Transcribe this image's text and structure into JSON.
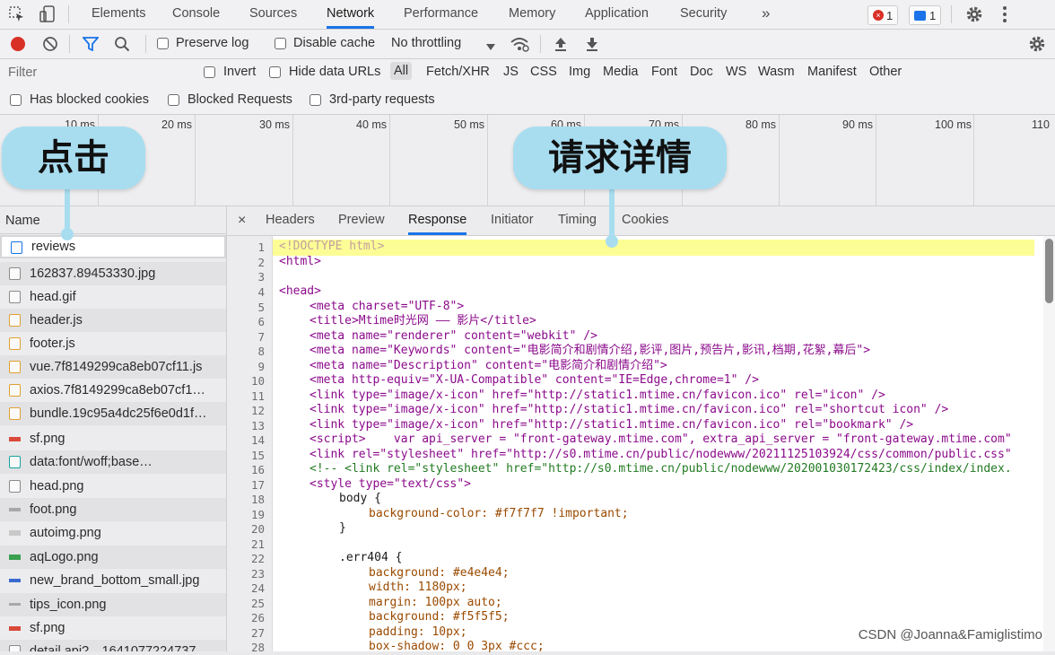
{
  "top_tabs": [
    "Elements",
    "Console",
    "Sources",
    "Network",
    "Performance",
    "Memory",
    "Application",
    "Security"
  ],
  "more_tabs": "»",
  "error_count": "1",
  "message_count": "1",
  "toolbar": {
    "preserve_log": "Preserve log",
    "disable_cache": "Disable cache",
    "throttling": "No throttling"
  },
  "filter": {
    "placeholder": "Filter",
    "invert": "Invert",
    "hide_data_urls": "Hide data URLs",
    "types": [
      "All",
      "Fetch/XHR",
      "JS",
      "CSS",
      "Img",
      "Media",
      "Font",
      "Doc",
      "WS",
      "Wasm",
      "Manifest",
      "Other"
    ]
  },
  "blocked": {
    "has_blocked_cookies": "Has blocked cookies",
    "blocked_requests": "Blocked Requests",
    "third_party": "3rd-party requests"
  },
  "timeline_ticks": [
    "10 ms",
    "20 ms",
    "30 ms",
    "40 ms",
    "50 ms",
    "60 ms",
    "70 ms",
    "80 ms",
    "90 ms",
    "100 ms",
    "110"
  ],
  "requests_header": "Name",
  "requests": [
    "reviews",
    "162837.89453330.jpg",
    "head.gif",
    "header.js",
    "footer.js",
    "vue.7f8149299ca8eb07cf11.js",
    "axios.7f8149299ca8eb07cf1…",
    "bundle.19c95a4dc25f6e0d1f…",
    "sf.png",
    "data:font/woff;base…",
    "head.png",
    "foot.png",
    "autoimg.png",
    "aqLogo.png",
    "new_brand_bottom_small.jpg",
    "tips_icon.png",
    "sf.png",
    "detail.api?…1641077224737"
  ],
  "detail_tabs": [
    "Headers",
    "Preview",
    "Response",
    "Initiator",
    "Timing",
    "Cookies"
  ],
  "detail_close": "×",
  "active_detail_tab": "Response",
  "line_numbers": [
    "1",
    "2",
    "3",
    "4",
    "5",
    "6",
    "7",
    "8",
    "9",
    "10",
    "11",
    "12",
    "13",
    "14",
    "15",
    "16",
    "17",
    "18",
    "19",
    "20",
    "21",
    "22",
    "23",
    "24",
    "25",
    "26",
    "27",
    "28"
  ],
  "code": {
    "l1": "<!DOCTYPE html>",
    "l2": "<html>",
    "l4": "<head>",
    "l5": "<meta charset=\"UTF-8\">",
    "l6": "<title>Mtime时光网 —— 影片</title>",
    "l7": "<meta name=\"renderer\" content=\"webkit\" />",
    "l8": "<meta name=\"Keywords\" content=\"电影简介和剧情介绍,影评,图片,预告片,影讯,档期,花絮,幕后\">",
    "l9": "<meta name=\"Description\" content=\"电影简介和剧情介绍\">",
    "l10": "<meta http-equiv=\"X-UA-Compatible\" content=\"IE=Edge,chrome=1\" />",
    "l11": "<link type=\"image/x-icon\" href=\"http://static1.mtime.cn/favicon.ico\" rel=\"icon\" />",
    "l12": "<link type=\"image/x-icon\" href=\"http://static1.mtime.cn/favicon.ico\" rel=\"shortcut icon\" />",
    "l13": "<link type=\"image/x-icon\" href=\"http://static1.mtime.cn/favicon.ico\" rel=\"bookmark\" />",
    "l14": "<script>    var api_server = \"front-gateway.mtime.com\", extra_api_server = \"front-gateway.mtime.com\"",
    "l15": "<link rel=\"stylesheet\" href=\"http://s0.mtime.cn/public/nodewww/20211125103924/css/common/public.css\"",
    "l16": "<!-- <link rel=\"stylesheet\" href=\"http://s0.mtime.cn/public/nodewww/202001030172423/css/index/index.",
    "l17": "<style type=\"text/css\">",
    "l18": "body {",
    "l19": "background-color: #f7f7f7 !important;",
    "l20": "}",
    "l22": ".err404 {",
    "l23": "background: #e4e4e4;",
    "l24": "width: 1180px;",
    "l25": "margin: 100px auto;",
    "l26": "background: #f5f5f5;",
    "l27": "padding: 10px;",
    "l28": "box-shadow: 0 0 3px #ccc;"
  },
  "callouts": {
    "click": "点击",
    "details": "请求详情"
  },
  "watermark": "CSDN @Joanna&Famiglistimo",
  "colors": {
    "accent": "#1a73e8",
    "callout": "#a8ddf0",
    "highlight": "#fdfd96",
    "record": "#d93025"
  }
}
